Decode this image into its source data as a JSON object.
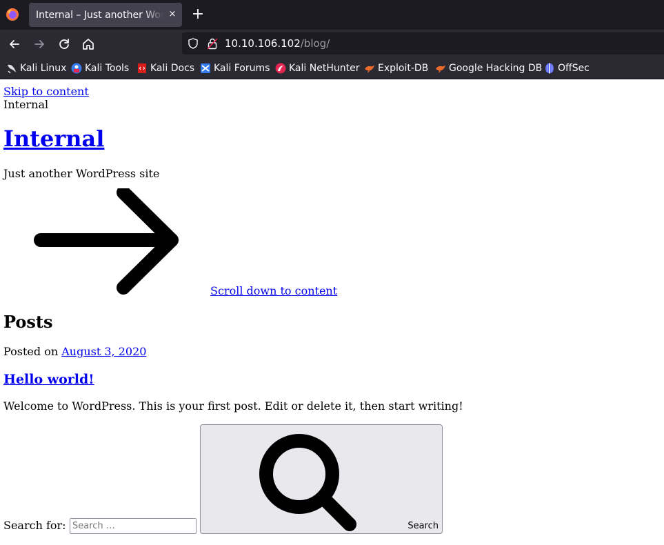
{
  "browser": {
    "tab_title": "Internal – Just another WordPress site",
    "tab_close": "×",
    "new_tab": "+",
    "url_host": "10.10.106.102",
    "url_path": "/blog/",
    "bookmarks": [
      {
        "label": "Kali Linux",
        "icon": "kali-dragon-icon"
      },
      {
        "label": "Kali Tools",
        "icon": "kali-tools-icon"
      },
      {
        "label": "Kali Docs",
        "icon": "kali-docs-icon"
      },
      {
        "label": "Kali Forums",
        "icon": "kali-forums-icon"
      },
      {
        "label": "Kali NetHunter",
        "icon": "kali-nethunter-icon"
      },
      {
        "label": "Exploit-DB",
        "icon": "exploit-db-icon"
      },
      {
        "label": "Google Hacking DB",
        "icon": "ghdb-icon"
      },
      {
        "label": "OffSec",
        "icon": "offsec-icon"
      }
    ]
  },
  "page": {
    "skip_link": "Skip to content",
    "site_name_small": "Internal",
    "site_title": "Internal",
    "tagline": "Just another WordPress site",
    "scroll_link": "Scroll down to content",
    "posts_heading": "Posts",
    "posted_on_label": "Posted on",
    "post_date": "August 3, 2020",
    "post_title": "Hello world!",
    "post_excerpt": "Welcome to WordPress. This is your first post. Edit or delete it, then start writing!",
    "search_label": "Search for:",
    "search_placeholder": "Search …",
    "search_button": "Search"
  },
  "colors": {
    "tabbar_bg": "#1c1b22",
    "toolbar_bg": "#2b2a33",
    "link": "#0000ee"
  }
}
